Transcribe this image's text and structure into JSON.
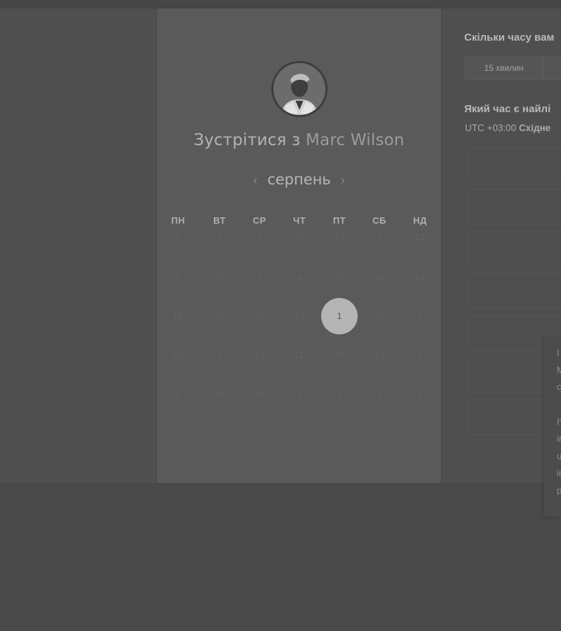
{
  "meeting": {
    "title_prefix": "Зустрітися з",
    "host_name": "Marc Wilson",
    "month": "серпень",
    "prev_icon": "‹",
    "next_icon": "›"
  },
  "calendar": {
    "weekdays": [
      "ПН",
      "ВТ",
      "СР",
      "ЧТ",
      "ПТ",
      "СБ",
      "НД"
    ],
    "rows": [
      [
        "5",
        "1",
        "7",
        "26",
        "13",
        "4",
        "12"
      ],
      [
        "3",
        "29",
        "8",
        "6",
        "27",
        "18",
        "14"
      ],
      [
        "15",
        "27",
        "27",
        "14",
        "1",
        "25",
        "5"
      ],
      [
        "26",
        "4",
        "14",
        "11",
        "29",
        "10",
        "3"
      ],
      [
        "2",
        "16",
        "29",
        "4",
        "6",
        "5",
        "7"
      ]
    ],
    "selected_day": "1"
  },
  "booking": {
    "duration_question": "Скільки часу вам",
    "duration_option": "15 хвилин",
    "time_question": "Який час є найлі",
    "timezone_offset": "UTC +03:00",
    "timezone_name": "Східне"
  },
  "popup": {
    "lines": [
      "I",
      "M",
      "c",
      "",
      "I'",
      "in",
      "u",
      "in",
      "p"
    ]
  }
}
